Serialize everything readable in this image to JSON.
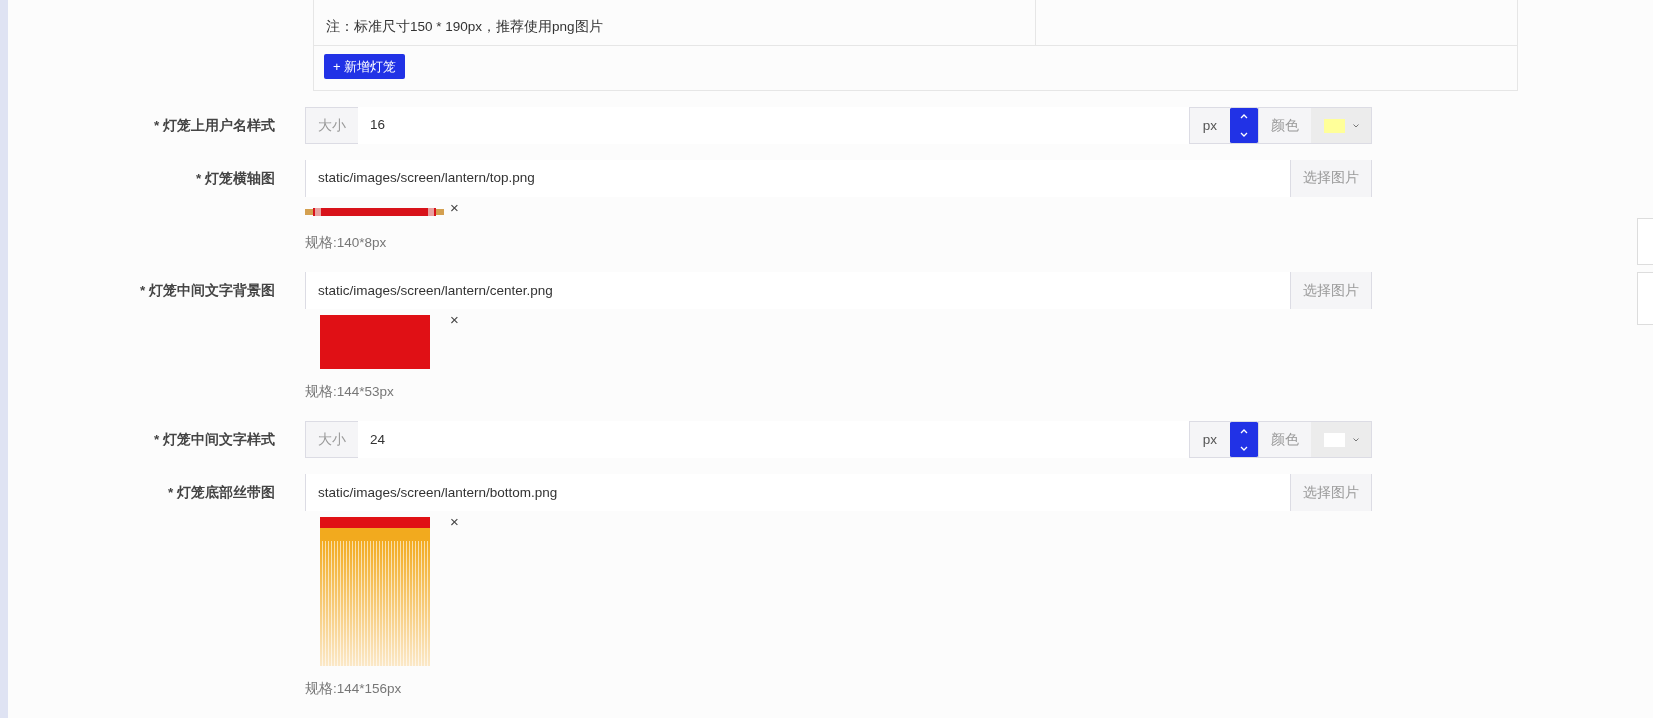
{
  "top_panel": {
    "note": "注：标准尺寸150 * 190px，推荐使用png图片",
    "add_button": "+ 新增灯笼"
  },
  "fields": [
    {
      "kind": "style",
      "label": "* 灯笼上用户名样式",
      "size_label": "大小",
      "size": "16",
      "unit": "px",
      "color_label": "颜色",
      "color": "#ffff99"
    },
    {
      "kind": "image",
      "label": "* 灯笼横轴图",
      "path": "static/images/screen/lantern/top.png",
      "button": "选择图片",
      "preview": {
        "kind": "rod"
      },
      "remove": "×",
      "spec": "规格:140*8px"
    },
    {
      "kind": "image",
      "label": "* 灯笼中间文字背景图",
      "path": "static/images/screen/lantern/center.png",
      "button": "选择图片",
      "preview": {
        "kind": "block"
      },
      "remove": "×",
      "spec": "规格:144*53px"
    },
    {
      "kind": "style",
      "label": "* 灯笼中间文字样式",
      "size_label": "大小",
      "size": "24",
      "unit": "px",
      "color_label": "颜色",
      "color": "#ffffff"
    },
    {
      "kind": "image",
      "label": "* 灯笼底部丝带图",
      "path": "static/images/screen/lantern/bottom.png",
      "button": "选择图片",
      "preview": {
        "kind": "tassel"
      },
      "remove": "×",
      "spec": "规格:144*156px"
    }
  ]
}
